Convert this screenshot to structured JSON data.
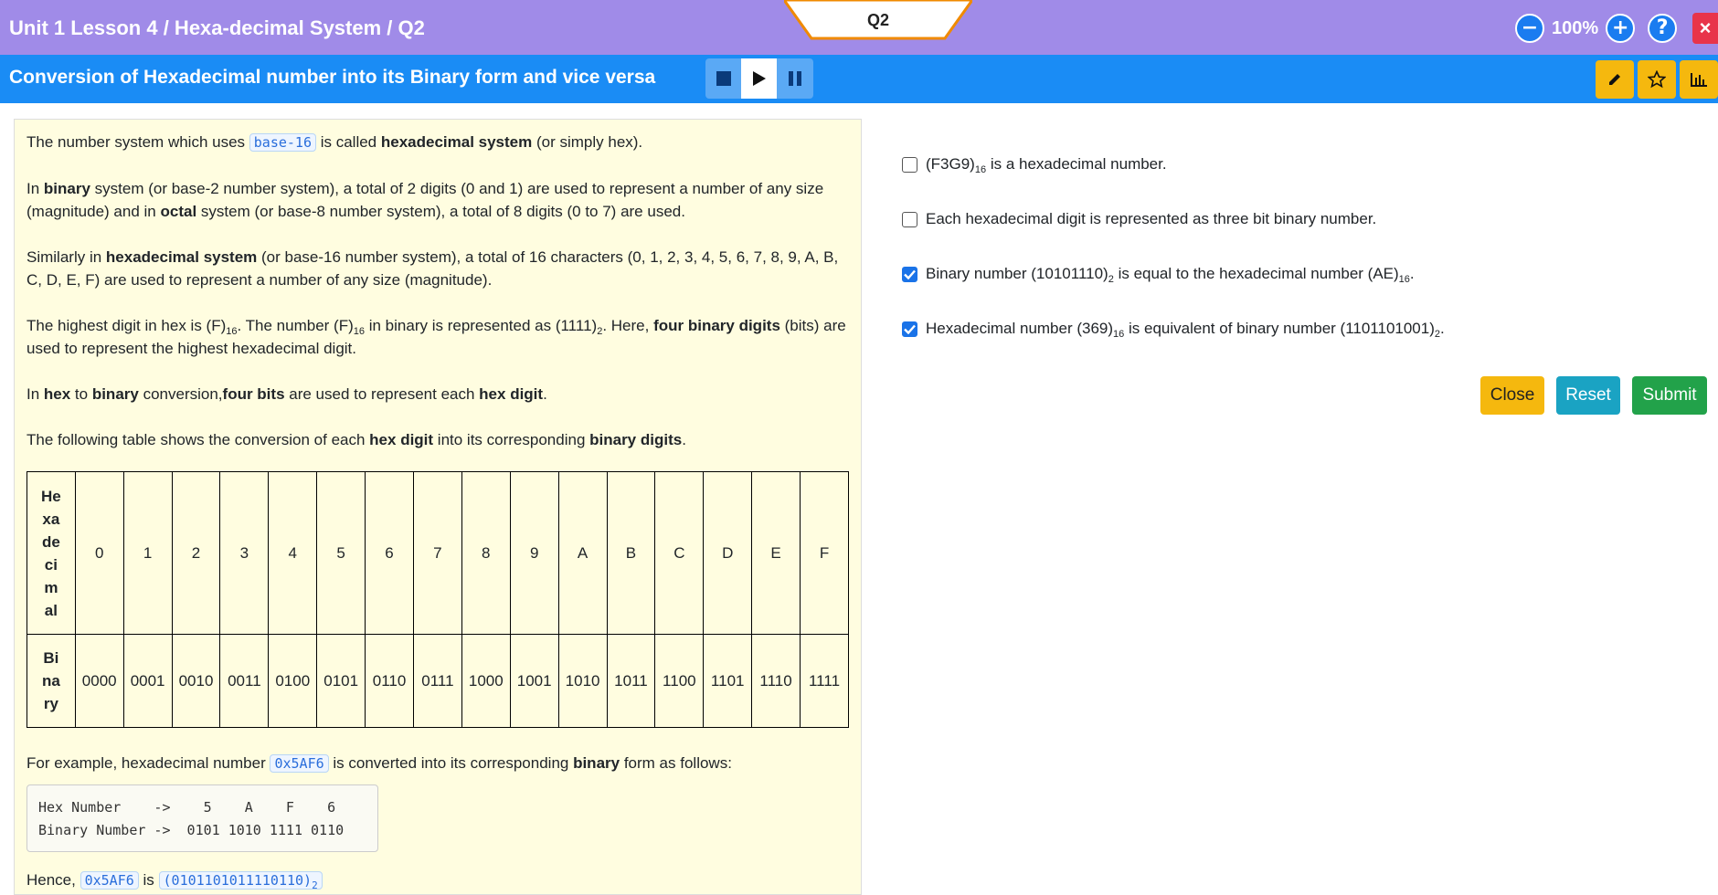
{
  "header": {
    "breadcrumb": "Unit 1 Lesson 4 / Hexa-decimal System / Q2",
    "question_tab": "Q2",
    "zoom_level": "100%",
    "zoom_out": "−",
    "zoom_in": "+",
    "help": "?",
    "close": "×"
  },
  "subheader": {
    "title": "Conversion of Hexadecimal number into its Binary form and vice versa"
  },
  "content": {
    "p1": {
      "pre": "The number system which uses ",
      "code": "base-16",
      "mid": " is called ",
      "bold": "hexadecimal system",
      "post": " (or simply hex)."
    },
    "p2": {
      "a": "In ",
      "b": "binary",
      "c": " system (or base-2 number system), a total of 2 digits (0 and 1) are used to represent a number of any size (magnitude) and in ",
      "d": "octal",
      "e": " system (or base-8 number system), a total of 8 digits (0 to 7) are used."
    },
    "p3": {
      "a": "Similarly in ",
      "b": "hexadecimal system",
      "c": " (or base-16 number system), a total of 16 characters (0, 1, 2, 3, 4, 5, 6, 7, 8, 9, A, B, C, D, E, F) are used to represent a number of any size (magnitude)."
    },
    "p4": {
      "a": "The highest digit in hex is (F)",
      "s1": "16",
      "b": ". The number (F)",
      "s2": "16",
      "c": " in binary is represented as (1111)",
      "s3": "2",
      "d": ". Here, ",
      "e": "four binary digits",
      "f": " (bits) are used to represent the highest hexadecimal digit."
    },
    "p5": {
      "a": "In ",
      "b": "hex",
      "c": " to ",
      "d": "binary",
      "e": " conversion,",
      "f": "four bits",
      "g": " are used to represent each ",
      "h": "hex digit",
      "i": "."
    },
    "p6": {
      "a": "The following table shows the conversion of each ",
      "b": "hex digit",
      "c": " into its corresponding ",
      "d": "binary digits",
      "e": "."
    },
    "table": {
      "hex_header_lines": [
        "He",
        "xa",
        "de",
        "ci",
        "m",
        "al"
      ],
      "bin_header_lines": [
        "Bi",
        "na",
        "ry"
      ],
      "hex": [
        "0",
        "1",
        "2",
        "3",
        "4",
        "5",
        "6",
        "7",
        "8",
        "9",
        "A",
        "B",
        "C",
        "D",
        "E",
        "F"
      ],
      "bin": [
        "0000",
        "0001",
        "0010",
        "0011",
        "0100",
        "0101",
        "0110",
        "0111",
        "1000",
        "1001",
        "1010",
        "1011",
        "1100",
        "1101",
        "1110",
        "1111"
      ]
    },
    "example": {
      "a": "For example, hexadecimal number ",
      "code": "0x5AF6",
      "b": " is converted into its corresponding ",
      "bold": "binary",
      "c": " form as follows:"
    },
    "codebox": "Hex Number    ->    5    A    F    6\nBinary Number ->  0101 1010 1111 0110",
    "hence": {
      "a": "Hence, ",
      "code1": "0x5AF6",
      "b": " is ",
      "code2": "(0101101011110110)",
      "sub": "2"
    }
  },
  "options": [
    {
      "checked": false,
      "a": "(F3G9)",
      "s1": "16",
      "b": " is a hexadecimal number.",
      "s2": "",
      "c": ""
    },
    {
      "checked": false,
      "a": "Each hexadecimal digit is represented as three bit binary number.",
      "s1": "",
      "b": "",
      "s2": "",
      "c": ""
    },
    {
      "checked": true,
      "a": "Binary number (10101110)",
      "s1": "2",
      "b": " is equal to the hexadecimal number (AE)",
      "s2": "16",
      "c": "."
    },
    {
      "checked": true,
      "a": "Hexadecimal number (369)",
      "s1": "16",
      "b": " is equivalent of binary number (1101101001)",
      "s2": "2",
      "c": "."
    }
  ],
  "buttons": {
    "close": "Close",
    "reset": "Reset",
    "submit": "Submit"
  },
  "colors": {
    "topbar": "#a08be8",
    "subbar": "#1a8cf5",
    "panel": "#fffde0",
    "accent_tab_border": "#f08a00"
  }
}
